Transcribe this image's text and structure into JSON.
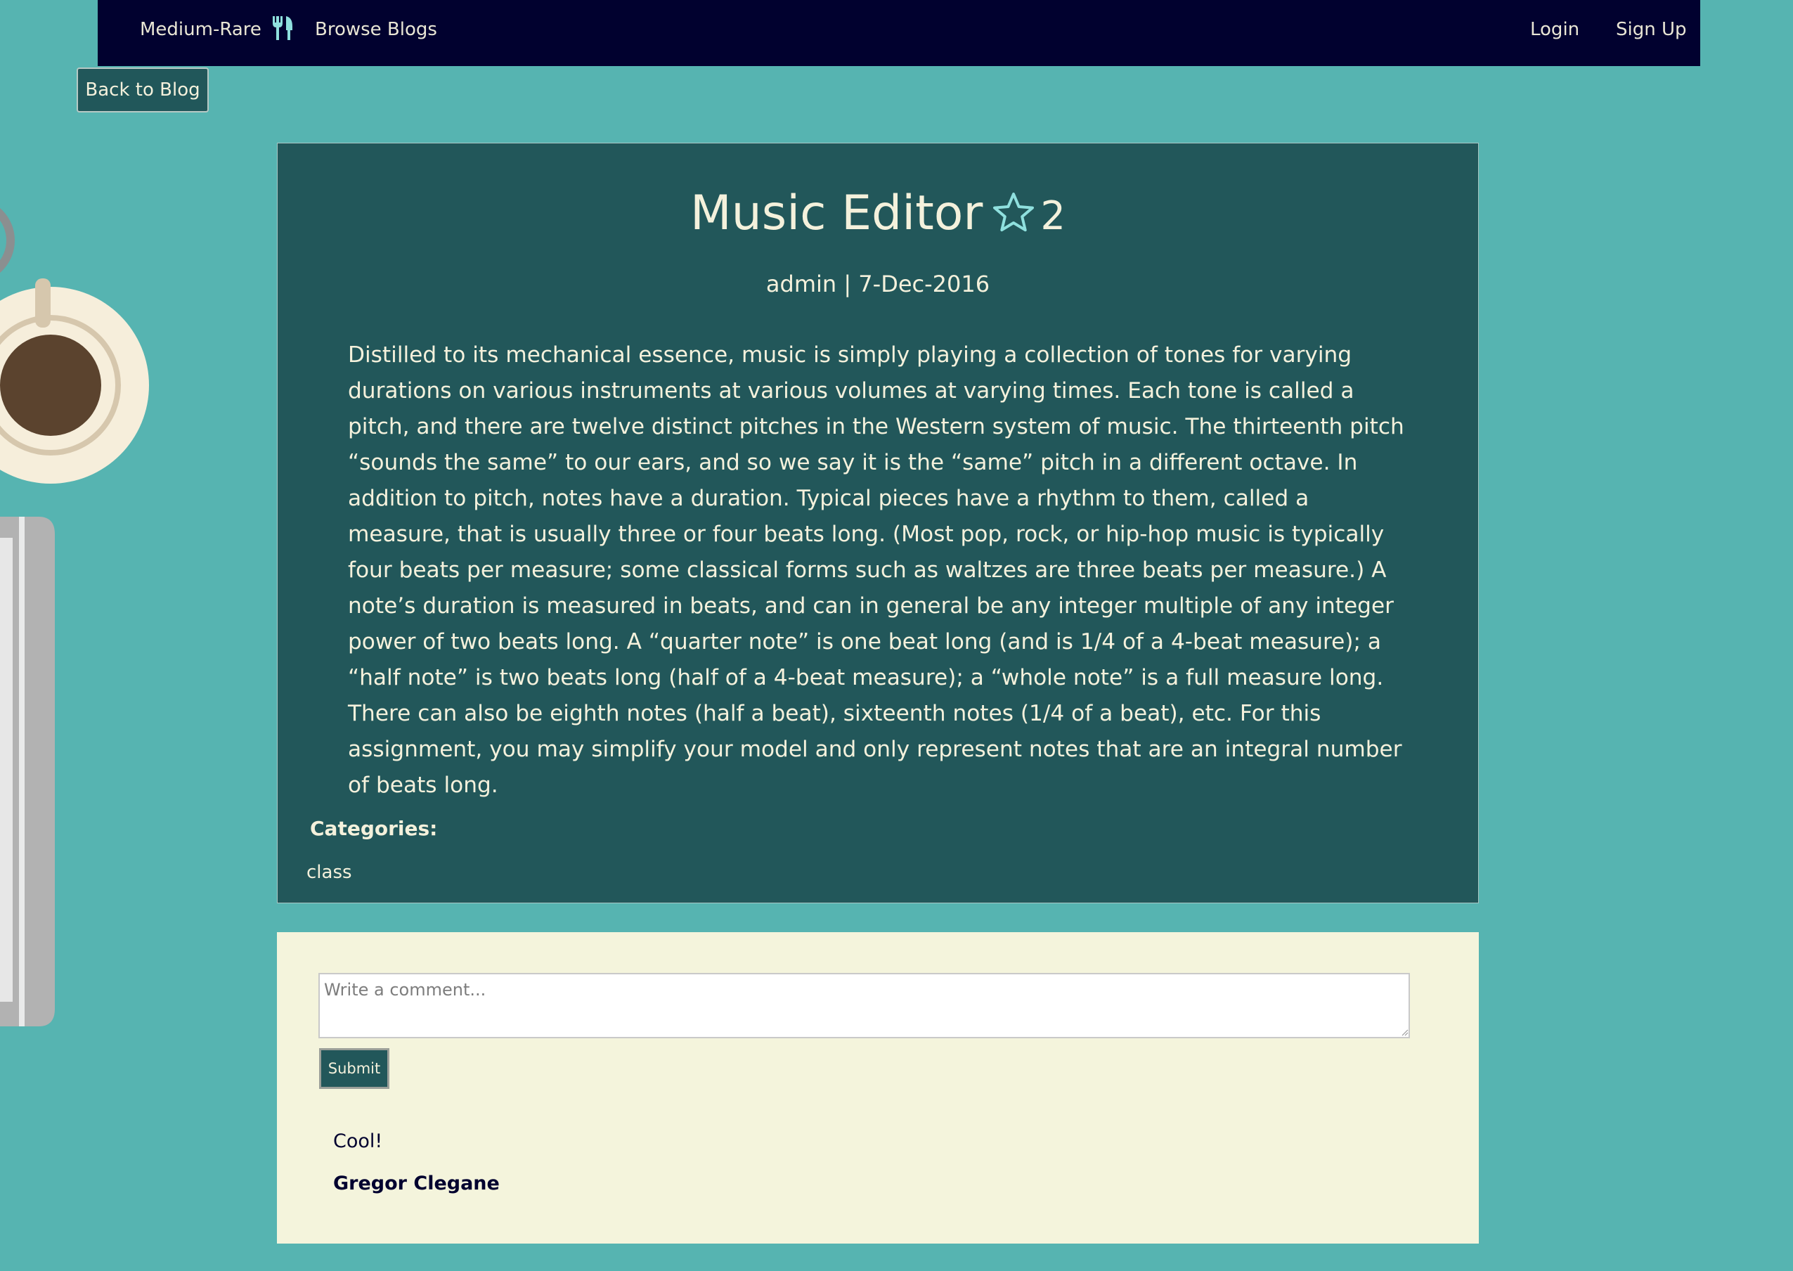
{
  "nav": {
    "brand": "Medium-Rare",
    "brand_icon": "fork-knife-icon",
    "browse": "Browse Blogs",
    "login": "Login",
    "signup": "Sign Up"
  },
  "back_button": "Back to Blog",
  "article": {
    "title": "Music Editor",
    "star_icon": "star-outline-icon",
    "star_count": "2",
    "meta": "admin | 7-Dec-2016",
    "body": "Distilled to its mechanical essence, music is simply playing a collection of tones for varying durations on various instruments at various volumes at varying times. Each tone is called a pitch, and there are twelve distinct pitches in the Western system of music. The thirteenth pitch “sounds the same” to our ears, and so we say it is the “same” pitch in a different octave. In addition to pitch, notes have a duration. Typical pieces have a rhythm to them, called a measure, that is usually three or four beats long. (Most pop, rock, or hip-hop music is typically four beats per measure; some classical forms such as waltzes are three beats per measure.) A note’s duration is measured in beats, and can in general be any integer multiple of any integer power of two beats long. A “quarter note” is one beat long (and is 1/4 of a 4-beat measure); a “half note” is two beats long (half of a 4-beat measure); a “whole note” is a full measure long. There can also be eighth notes (half a beat), sixteenth notes (1/4 of a beat), etc. For this assignment, you may simplify your model and only represent notes that are an integral number of beats long.",
    "categories_heading": "Categories:",
    "categories": [
      "class"
    ]
  },
  "comments": {
    "placeholder": "Write a comment...",
    "submit": "Submit",
    "items": [
      {
        "text": "Cool!",
        "author": "Gregor Clegane"
      }
    ]
  },
  "colors": {
    "page_background": "#56b4b1",
    "navbar": "#01012f",
    "card": "#22575a",
    "comments_background": "#f4f4dc",
    "text_light": "#f4f1dc",
    "star": "#8fe0de"
  }
}
